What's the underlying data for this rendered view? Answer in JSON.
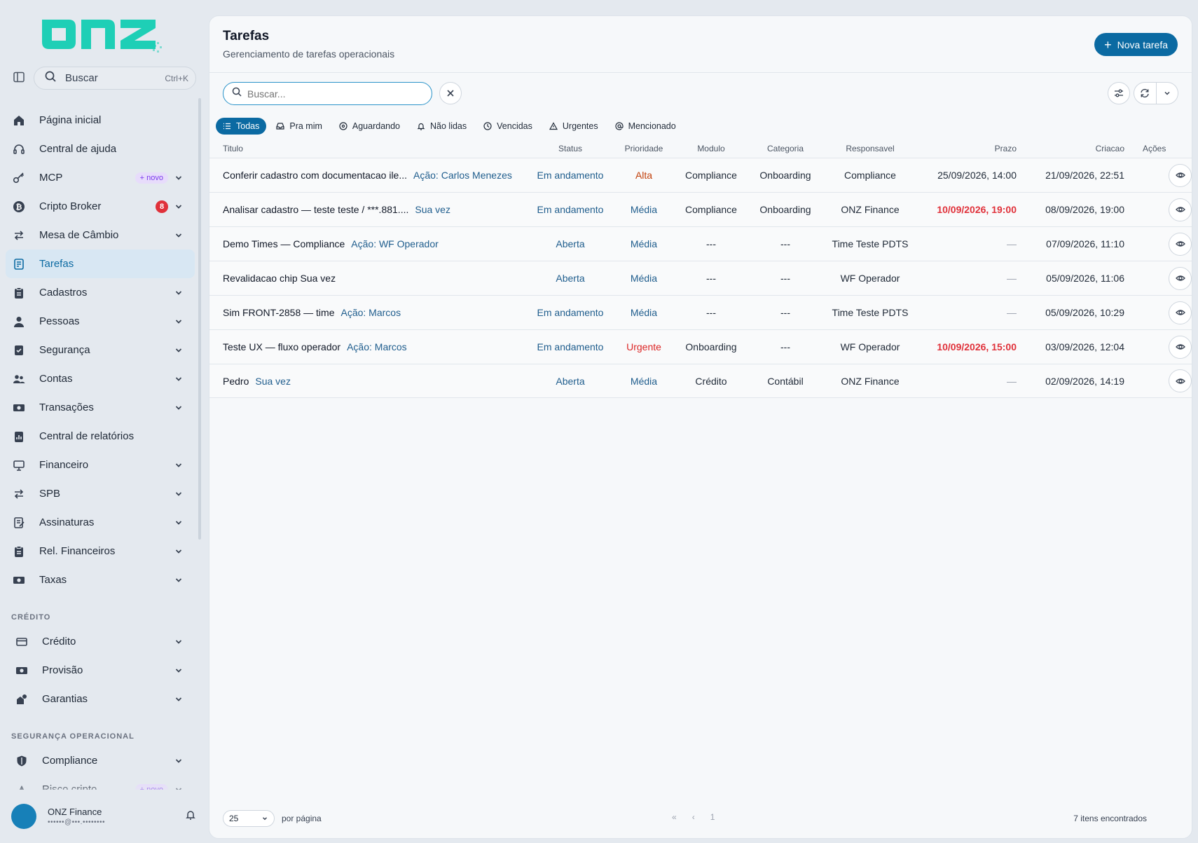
{
  "brand": {
    "logo_text": "onz"
  },
  "sidebar": {
    "search": {
      "label": "Buscar",
      "shortcut": "Ctrl+K"
    },
    "items": [
      {
        "label": "Página inicial",
        "icon": "home-icon"
      },
      {
        "label": "Central de ajuda",
        "icon": "headset-icon"
      },
      {
        "label": "MCP",
        "icon": "key-icon",
        "badge": "+ novo"
      },
      {
        "label": "Cripto Broker",
        "icon": "bitcoin-icon",
        "count": "8"
      },
      {
        "label": "Mesa de Câmbio",
        "icon": "exchange-icon"
      },
      {
        "label": "Tarefas",
        "icon": "tasks-icon",
        "active": true
      },
      {
        "label": "Cadastros",
        "icon": "clipboard-icon"
      },
      {
        "label": "Pessoas",
        "icon": "person-icon"
      },
      {
        "label": "Segurança",
        "icon": "shield-check-icon"
      },
      {
        "label": "Contas",
        "icon": "users-icon"
      },
      {
        "label": "Transações",
        "icon": "money-icon"
      },
      {
        "label": "Central de relatórios",
        "icon": "report-icon"
      },
      {
        "label": "Financeiro",
        "icon": "monitor-icon"
      },
      {
        "label": "SPB",
        "icon": "exchange-icon"
      },
      {
        "label": "Assinaturas",
        "icon": "signature-icon"
      },
      {
        "label": "Rel. Financeiros",
        "icon": "clipboard-icon"
      },
      {
        "label": "Taxas",
        "icon": "money-icon"
      }
    ],
    "credito_section": {
      "title": "CRÉDITO",
      "items": [
        {
          "label": "Crédito",
          "icon": "card-icon"
        },
        {
          "label": "Provisão",
          "icon": "money-icon"
        },
        {
          "label": "Garantias",
          "icon": "guarantee-icon"
        }
      ]
    },
    "seg_section": {
      "title": "SEGURANÇA OPERACIONAL",
      "items": [
        {
          "label": "Compliance",
          "icon": "shield-icon"
        },
        {
          "label": "Risco cripto",
          "icon": "risk-icon",
          "badge": "+ novo"
        }
      ]
    },
    "user": {
      "name": "ONZ Finance",
      "email": "••••••@•••.••••••••"
    }
  },
  "header": {
    "title": "Tarefas",
    "subtitle": "Gerenciamento de tarefas operacionais",
    "new_button": "Nova tarefa"
  },
  "filters": {
    "search_placeholder": "Buscar...",
    "chips": [
      {
        "label": "Todas",
        "icon": "list-icon",
        "active": true
      },
      {
        "label": "Pra mim",
        "icon": "inbox-icon"
      },
      {
        "label": "Aguardando",
        "icon": "clock-circle-icon"
      },
      {
        "label": "Não lidas",
        "icon": "bell-icon"
      },
      {
        "label": "Vencidas",
        "icon": "clock-icon"
      },
      {
        "label": "Urgentes",
        "icon": "warning-icon"
      },
      {
        "label": "Mencionado",
        "icon": "at-icon"
      }
    ]
  },
  "table": {
    "columns": [
      "Titulo",
      "Status",
      "Prioridade",
      "Modulo",
      "Categoria",
      "Responsavel",
      "Prazo",
      "Criacao",
      "Ações"
    ],
    "rows": [
      {
        "title": "Conferir cadastro com documentacao ile...",
        "who": "Ação: Carlos Menezes",
        "status": "Em andamento",
        "priority": "Alta",
        "priority_level": "alta",
        "module": "Compliance",
        "category": "Onboarding",
        "owner": "Compliance",
        "deadline": "25/09/2026, 14:00",
        "overdue": false,
        "created": "21/09/2026, 22:51"
      },
      {
        "title": "Analisar cadastro — teste teste / ***.881....",
        "who": "Sua vez",
        "status": "Em andamento",
        "priority": "Média",
        "priority_level": "media",
        "module": "Compliance",
        "category": "Onboarding",
        "owner": "ONZ Finance",
        "deadline": "10/09/2026, 19:00",
        "overdue": true,
        "created": "08/09/2026, 19:00"
      },
      {
        "title": "Demo Times — Compliance",
        "who": "Ação: WF Operador",
        "status": "Aberta",
        "priority": "Média",
        "priority_level": "media",
        "module": "---",
        "category": "---",
        "owner": "Time Teste PDTS",
        "deadline": "—",
        "overdue": false,
        "created": "07/09/2026, 11:10"
      },
      {
        "title": "Revalidacao chip Sua vez",
        "who": "",
        "status": "Aberta",
        "priority": "Média",
        "priority_level": "media",
        "module": "---",
        "category": "---",
        "owner": "WF Operador",
        "deadline": "—",
        "overdue": false,
        "created": "05/09/2026, 11:06"
      },
      {
        "title": "Sim FRONT-2858 — time",
        "who": "Ação: Marcos",
        "status": "Em andamento",
        "priority": "Média",
        "priority_level": "media",
        "module": "---",
        "category": "---",
        "owner": "Time Teste PDTS",
        "deadline": "—",
        "overdue": false,
        "created": "05/09/2026, 10:29"
      },
      {
        "title": "Teste UX — fluxo operador",
        "who": "Ação: Marcos",
        "status": "Em andamento",
        "priority": "Urgente",
        "priority_level": "urgente",
        "module": "Onboarding",
        "category": "---",
        "owner": "WF Operador",
        "deadline": "10/09/2026, 15:00",
        "overdue": true,
        "created": "03/09/2026, 12:04"
      },
      {
        "title": "Pedro",
        "who": "Sua vez",
        "status": "Aberta",
        "priority": "Média",
        "priority_level": "media",
        "module": "Crédito",
        "category": "Contábil",
        "owner": "ONZ Finance",
        "deadline": "—",
        "overdue": false,
        "created": "02/09/2026, 14:19"
      }
    ]
  },
  "footer": {
    "per_page_value": "25",
    "per_page_label": "por página",
    "current_page": "1",
    "count_label": "7 itens encontrados"
  }
}
